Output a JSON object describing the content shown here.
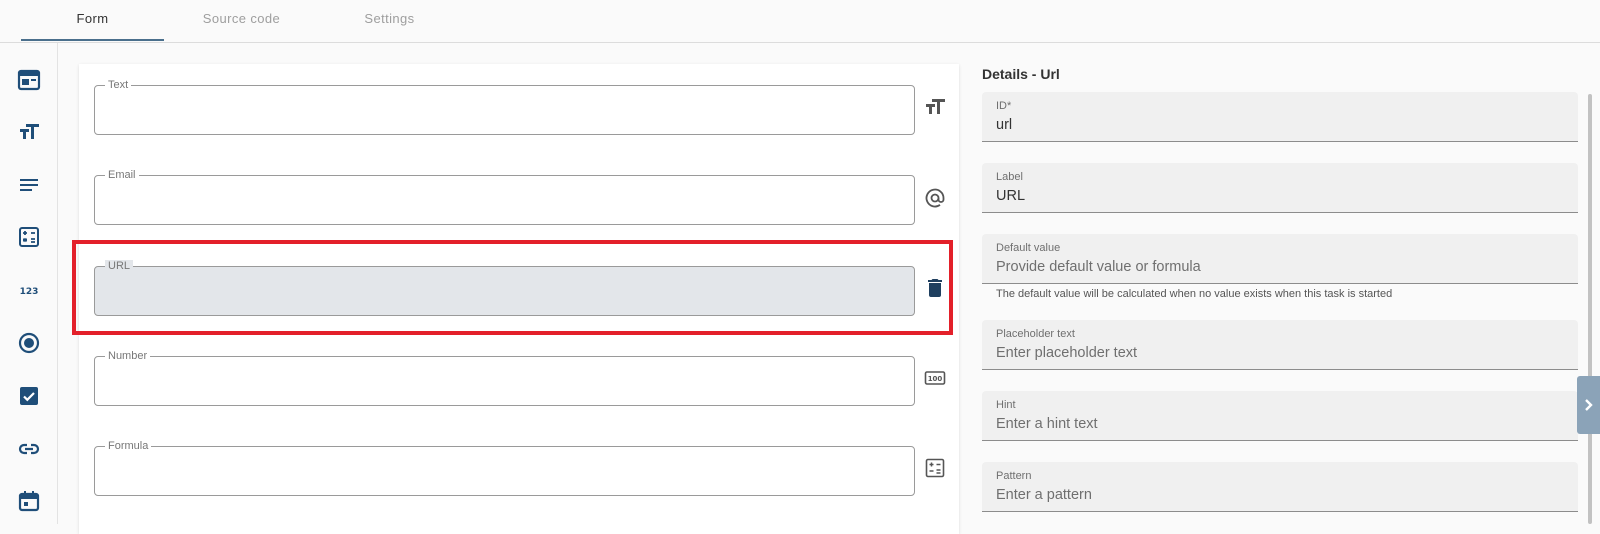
{
  "tabs": [
    {
      "label": "Form",
      "active": true
    },
    {
      "label": "Source code",
      "active": false
    },
    {
      "label": "Settings",
      "active": false
    }
  ],
  "palette": {
    "icons": [
      "layout-icon",
      "text-size-icon",
      "paragraph-icon",
      "calculator-icon",
      "number-icon",
      "radio-icon",
      "checkbox-icon",
      "link-icon",
      "calendar-icon"
    ],
    "icon_color": "#1f4e79"
  },
  "form": {
    "fields": [
      {
        "label": "Text",
        "icon": "text-size-icon"
      },
      {
        "label": "Email",
        "icon": "at-icon"
      },
      {
        "label": "URL",
        "icon": "delete-icon",
        "selected": true
      },
      {
        "label": "Number",
        "icon": "number-box-icon"
      },
      {
        "label": "Formula",
        "icon": "calculator-outline-icon"
      }
    ]
  },
  "details": {
    "title": "Details - Url",
    "fields": [
      {
        "label": "ID*",
        "value": "url",
        "placeholder": false
      },
      {
        "label": "Label",
        "value": "URL",
        "placeholder": false
      },
      {
        "label": "Default value",
        "value": "Provide default value or formula",
        "placeholder": true
      },
      {
        "label": "Placeholder text",
        "value": "Enter placeholder text",
        "placeholder": true
      },
      {
        "label": "Hint",
        "value": "Enter a hint text",
        "placeholder": true
      },
      {
        "label": "Pattern",
        "value": "Enter a pattern",
        "placeholder": true
      }
    ],
    "default_hint": "The default value will be calculated when no value exists when this task is started"
  },
  "colors": {
    "selection_border": "#e3202a",
    "accent": "#4a6f8c"
  }
}
